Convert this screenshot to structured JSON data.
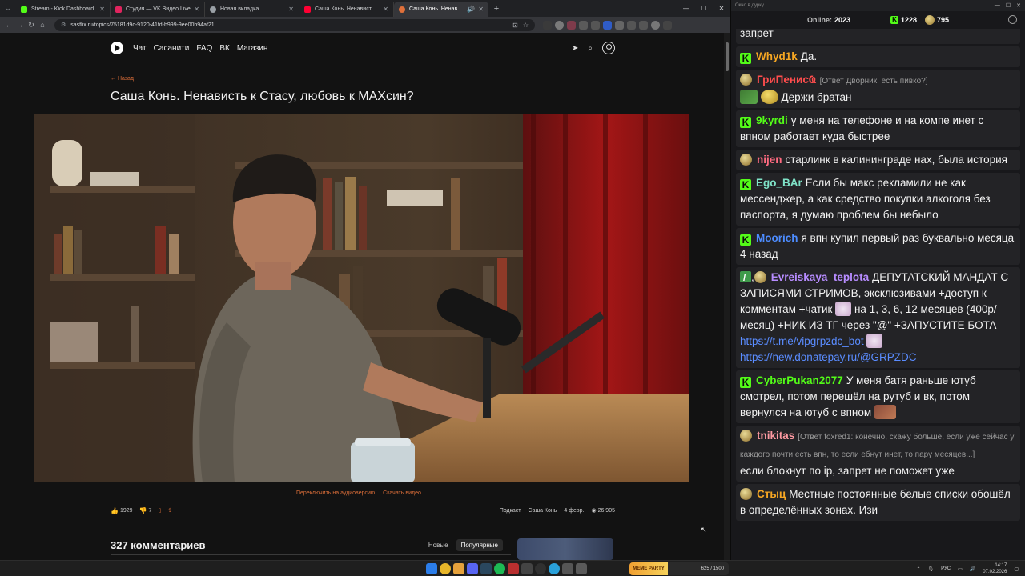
{
  "browser": {
    "tabs": [
      {
        "label": "Stream - Kick Dashboard",
        "color": "#53fc18"
      },
      {
        "label": "Студия — VK Видео Live",
        "color": "#e0245e"
      },
      {
        "label": "Новая вкладка",
        "color": "#9aa0a6"
      },
      {
        "label": "Саша Конь. Ненависть к Стасу",
        "color": "#ff0033"
      },
      {
        "label": "Саша Конь. Ненависть к С",
        "color": "#e0703a"
      }
    ],
    "url": "sasflix.ru/topics/75181d9c-9120-41fd-b999-9ee00b94af21"
  },
  "site": {
    "nav": [
      "Чат",
      "Сасанити",
      "FAQ",
      "ВК",
      "Магазин"
    ],
    "back_label": "← Назад",
    "title": "Саша Конь. Ненависть к Стасу, любовь к МАХсин?",
    "audio_link": "Переключить на аудиоверсию",
    "download_link": "Скачать видео",
    "likes": "1929",
    "dislikes": "7",
    "tags": [
      "Подкаст",
      "Саша Конь"
    ],
    "date": "4 февр.",
    "views": "26 905",
    "comments_title": "327 комментариев",
    "sort_new": "Новые",
    "sort_popular": "Популярные"
  },
  "chat": {
    "window_title": "Окно в дурку",
    "online_label": "Online:",
    "online_count": "2023",
    "kick_count": "1228",
    "other_count": "795",
    "messages": [
      {
        "user": "",
        "user_color": "#ffffff",
        "badge": "none",
        "reply": "",
        "text": "запрет"
      },
      {
        "user": "Whyd1k",
        "user_color": "#f5a623",
        "badge": "kick",
        "reply": "",
        "text": "Да."
      },
      {
        "user": "ГриПенисҨ",
        "user_color": "#ff4d4d",
        "badge": "face",
        "reply": "[Ответ Дворник: есть пивко?]",
        "text": "Держи братан"
      },
      {
        "user": "9kyrdi",
        "user_color": "#53fc18",
        "badge": "kick",
        "reply": "",
        "text": "у меня на телефоне и на компе инет с впном работает куда быстрее"
      },
      {
        "user": "nijen",
        "user_color": "#ff6b81",
        "badge": "face",
        "reply": "",
        "text": "старлинк в калининграде нах, была история"
      },
      {
        "user": "Ego_BAr",
        "user_color": "#7fe3c8",
        "badge": "kick",
        "reply": "",
        "text": "Если бы макс рекламили не как мессенджер, а как средство покупки алкоголя без паспорта, я думаю проблем бы небыло"
      },
      {
        "user": "Moorich",
        "user_color": "#4d8cff",
        "badge": "kick",
        "reply": "",
        "text": "я впн купил первый раз буквально месяца 4 назад"
      },
      {
        "user": "Evreiskaya_teplota",
        "user_color": "#b78cff",
        "badge": "pen-face",
        "reply": "",
        "text_parts": [
          "ДЕПУТАТСКИЙ МАНДАТ С ЗАПИСЯМИ СТРИМОВ, эксклюзивами +доступ к комментам +чатик",
          "на 1, 3, 6, 12 месяцев (400р/месяц) +НИК ИЗ ТГ через \"@\" +ЗАПУСТИТЕ БОТА"
        ],
        "link1": "https://t.me/vipgrpzdc_bot",
        "link2": "https://new.donatepay.ru/@GRPZDC"
      },
      {
        "user": "CyberPukan2077",
        "user_color": "#53fc18",
        "badge": "kick",
        "reply": "",
        "text": "У меня батя раньше ютуб смотрел, потом перешёл на рутуб и вк, потом вернулся на ютуб с впном"
      },
      {
        "user": "tnikitas",
        "user_color": "#ff9aa2",
        "badge": "face",
        "reply": "[Ответ foxred1: конечно, скажу больше, если уже сейчас у каждого почти есть впн, то если ебнут инет, то пару месяцев...]",
        "text": "если блокнут по ip, запрет не поможет уже"
      },
      {
        "user": "Стыц",
        "user_color": "#f5a623",
        "badge": "face",
        "reply": "",
        "text": "Местные постоянные белые списки обошёл в определённых зонах. Изи"
      }
    ]
  },
  "taskbar": {
    "widget_label": "MEME PARTY",
    "widget_value": "625 / 1500",
    "lang": "РУС",
    "time": "14:17",
    "date": "07.02.2026"
  },
  "colors": {
    "accent": "#e0703a",
    "kick": "#53fc18"
  }
}
